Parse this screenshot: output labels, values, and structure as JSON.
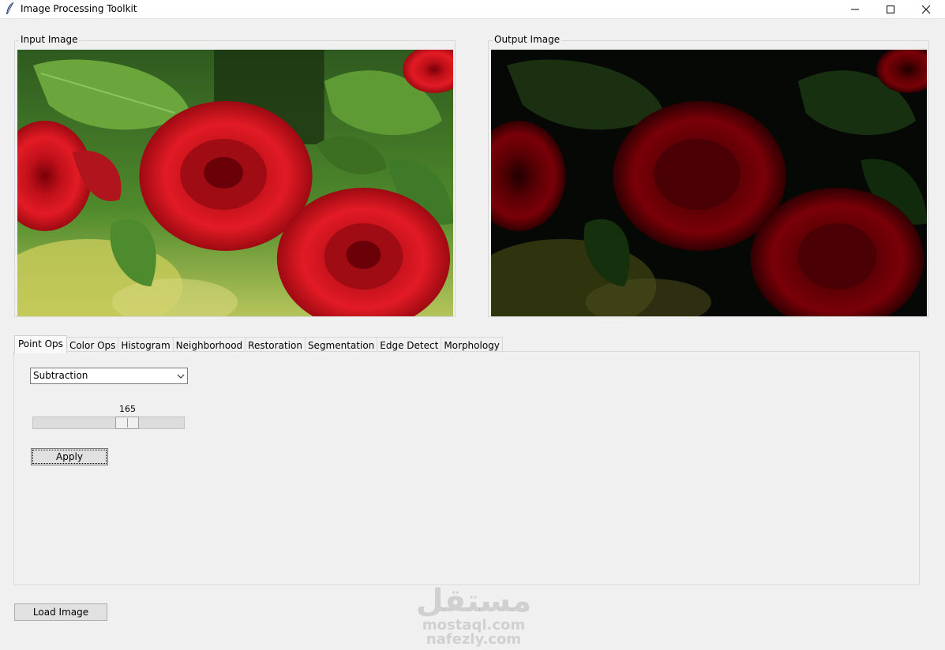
{
  "window": {
    "title": "Image Processing Toolkit",
    "icon": "feather-icon",
    "controls": [
      "minimize-icon",
      "maximize-icon",
      "close-icon"
    ]
  },
  "input_frame": {
    "label": "Input Image"
  },
  "output_frame": {
    "label": "Output Image"
  },
  "tabs": [
    {
      "label": "Point Ops",
      "active": true
    },
    {
      "label": "Color Ops",
      "active": false
    },
    {
      "label": "Histogram",
      "active": false
    },
    {
      "label": "Neighborhood",
      "active": false
    },
    {
      "label": "Restoration",
      "active": false
    },
    {
      "label": "Segmentation",
      "active": false
    },
    {
      "label": "Edge Detect",
      "active": false
    },
    {
      "label": "Morphology",
      "active": false
    }
  ],
  "point_ops": {
    "operation": "Subtraction",
    "scale": {
      "value": "165",
      "min": 0,
      "max": 255,
      "level": 165
    },
    "apply_label": "Apply"
  },
  "footer": {
    "load_label": "Load Image"
  },
  "watermark": {
    "arabic": "مستقل",
    "latin1": "mostaql.com",
    "latin2": "nafezly.com"
  },
  "colors": {
    "background": "#f0f0f0",
    "rose": "#d0141c",
    "leaf": "#3f7d2a"
  }
}
